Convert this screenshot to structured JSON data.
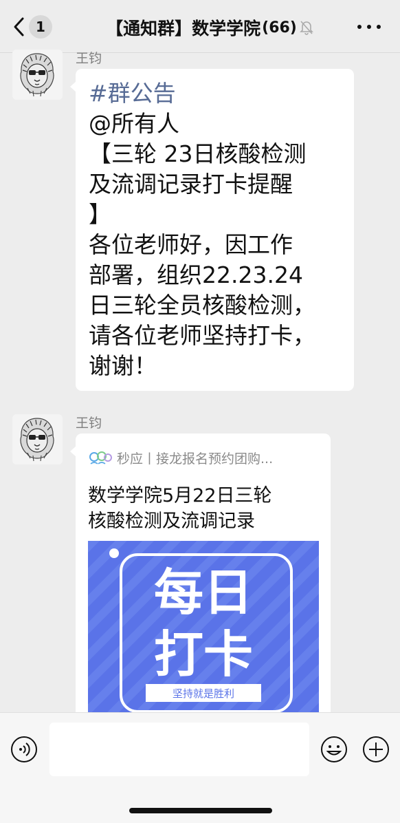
{
  "header": {
    "back_count": "1",
    "title": "【通知群】数学学院",
    "member_count": "(66)",
    "muted_icon": "bell-mute-icon",
    "more_icon": "ellipsis-icon"
  },
  "messages": [
    {
      "sender": "王钧",
      "tag": "#群公告",
      "lines": [
        "@所有人",
        "【三轮 23日核酸检测",
        "及流调记录打卡提醒",
        "】",
        "各位老师好，因工作",
        "部署，组织22.23.24",
        "日三轮全员核酸检测，",
        "请各位老师坚持打卡，",
        "谢谢！"
      ]
    },
    {
      "sender": "王钧",
      "card": {
        "source": "秒应丨接龙报名预约团购...",
        "title_lines": [
          "数学学院5月22日三轮",
          "核酸检测及流调记录"
        ],
        "image": {
          "line1": "每日",
          "line2": "打卡",
          "banner": "坚持就是胜利",
          "bg_color": "#5a73e8"
        }
      }
    }
  ],
  "input_bar": {
    "voice_icon": "voice-icon",
    "emoji_icon": "emoji-icon",
    "plus_icon": "plus-icon",
    "text_value": ""
  }
}
